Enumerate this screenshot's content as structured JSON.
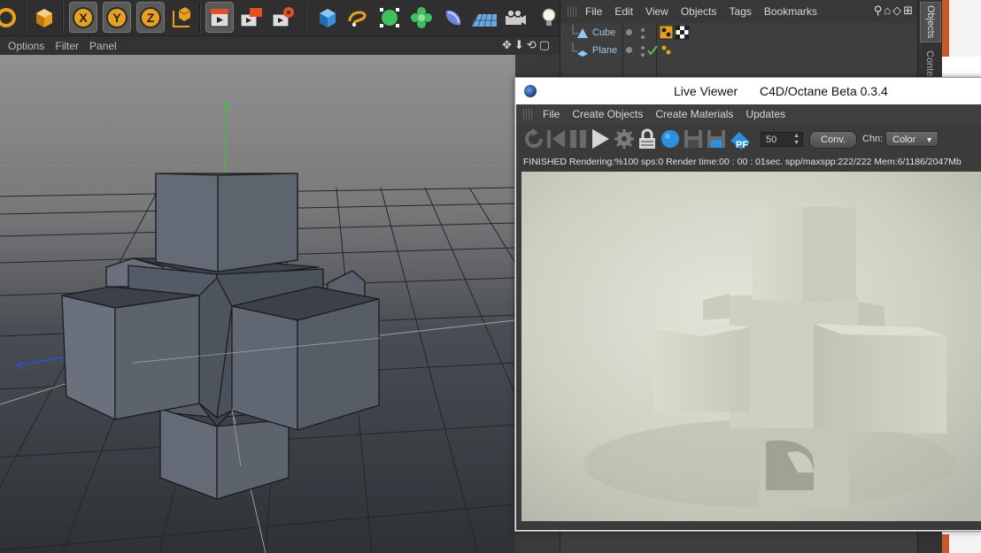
{
  "viewport_menu": {
    "options": "Options",
    "filter": "Filter",
    "panel": "Panel"
  },
  "toolbar": {
    "icons": [
      "undo-icon",
      "model-mode-icon",
      "x-axis-lock-icon",
      "y-axis-lock-icon",
      "z-axis-lock-icon",
      "coordinate-system-icon",
      "render-view-icon",
      "render-to-picture-viewer-icon",
      "render-settings-icon",
      "cube-primitive-icon",
      "spline-icon",
      "nurbs-icon",
      "array-icon",
      "deformer-icon",
      "floor-icon",
      "camera-icon",
      "light-icon"
    ],
    "axis_x": "X",
    "axis_y": "Y",
    "axis_z": "Z"
  },
  "object_manager": {
    "menu": [
      "File",
      "Edit",
      "View",
      "Objects",
      "Tags",
      "Bookmarks"
    ],
    "objects": [
      {
        "name": "Cube"
      },
      {
        "name": "Plane"
      }
    ]
  },
  "side_tabs": {
    "objects": "Objects",
    "content": "Conte"
  },
  "live_viewer": {
    "title": "Live Viewer",
    "subtitle": "C4D/Octane Beta 0.3.4",
    "menu": [
      "File",
      "Create Objects",
      "Create Materials",
      "Updates"
    ],
    "spp_value": "50",
    "conv_label": "Conv.",
    "channel_label": "Chn:",
    "channel_value": "Color",
    "status": "FINISHED Rendering:%100 sps:0 Render time:00 : 00 : 01sec. spp/maxspp:222/222 Mem:6/1186/2047Mb"
  },
  "colors": {
    "accent": "#e8a020",
    "link": "#9ec6e8",
    "status_ok": "#4fc04f"
  }
}
